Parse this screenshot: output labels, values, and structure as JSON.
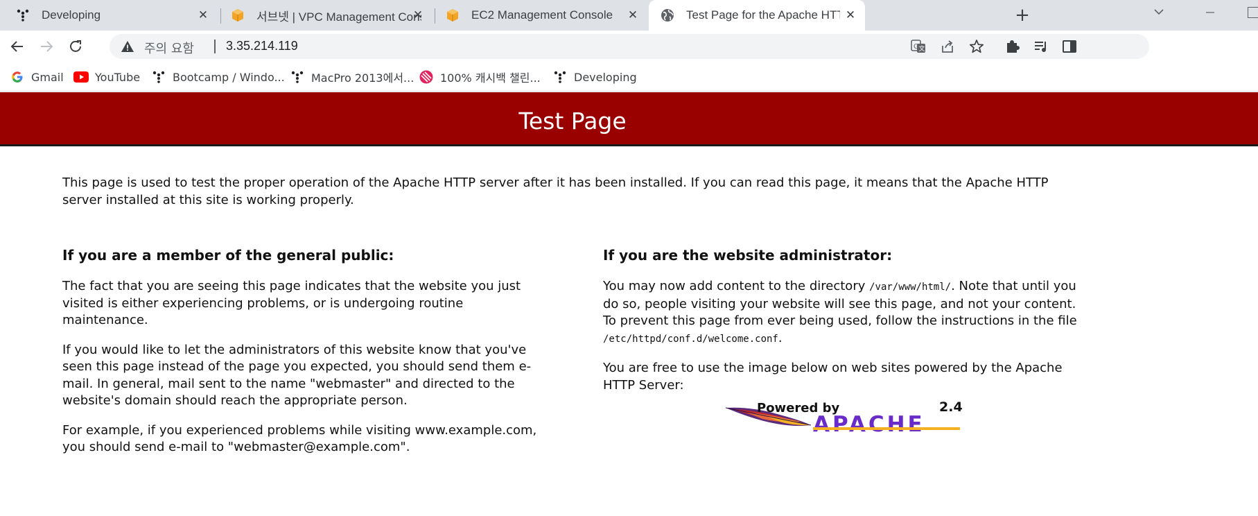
{
  "browser": {
    "tabs": [
      {
        "title": "Developing",
        "icon": "developing-favicon-icon"
      },
      {
        "title": "서브넷 | VPC Management Cons",
        "icon": "aws-cube-icon"
      },
      {
        "title": "EC2 Management Console",
        "icon": "aws-cube-icon"
      },
      {
        "title": "Test Page for the Apache HTTP",
        "icon": "globe-icon",
        "active": true
      }
    ],
    "new_tab": "+",
    "tab_close": "✕",
    "address": {
      "security_label": "주의 요함",
      "url": "3.35.214.119"
    },
    "bookmarks": [
      {
        "label": "Gmail",
        "icon": "google-icon"
      },
      {
        "label": "YouTube",
        "icon": "youtube-icon"
      },
      {
        "label": "Bootcamp / Windo...",
        "icon": "developing-favicon-icon"
      },
      {
        "label": "MacPro 2013에서...",
        "icon": "developing-favicon-icon"
      },
      {
        "label": "100% 캐시백 챌린...",
        "icon": "challenge-icon"
      },
      {
        "label": "Developing",
        "icon": "developing-favicon-icon"
      }
    ]
  },
  "page": {
    "banner_title": "Test Page",
    "intro": "This page is used to test the proper operation of the Apache HTTP server after it has been installed. If you can read this page, it means that the Apache HTTP server installed at this site is working properly.",
    "public": {
      "heading": "If you are a member of the general public:",
      "p1": "The fact that you are seeing this page indicates that the website you just visited is either experiencing problems, or is undergoing routine maintenance.",
      "p2": "If you would like to let the administrators of this website know that you've seen this page instead of the page you expected, you should send them e-mail. In general, mail sent to the name \"webmaster\" and directed to the website's domain should reach the appropriate person.",
      "p3": "For example, if you experienced problems while visiting www.example.com, you should send e-mail to \"webmaster@example.com\"."
    },
    "admin": {
      "heading": "If you are the website administrator:",
      "p1_a": "You may now add content to the directory ",
      "p1_dir": "/var/www/html/",
      "p1_b": ". Note that until you do so, people visiting your website will see this page, and not your content. To prevent this page from ever being used, follow the instructions in the file ",
      "p1_file": "/etc/httpd/conf.d/welcome.conf",
      "p1_c": ".",
      "p2": "You are free to use the image below on web sites powered by the Apache HTTP Server:"
    },
    "powered_by": {
      "text1": "Powered by",
      "text2": "APACHE",
      "version": "2.4"
    }
  },
  "colors": {
    "banner": "#990000",
    "tabstrip": "#dee1e6"
  }
}
